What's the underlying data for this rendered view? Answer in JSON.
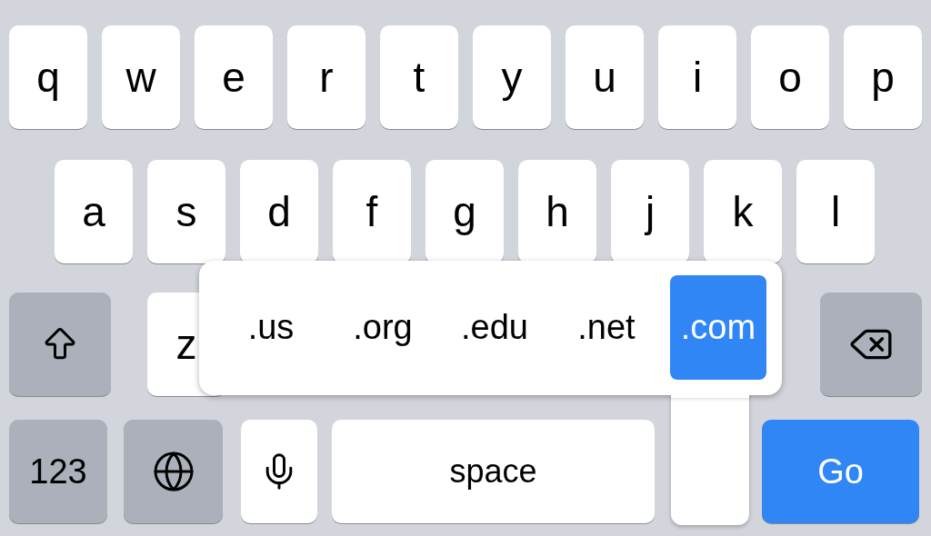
{
  "rows": [
    {
      "keys": [
        {
          "kind": "letter",
          "label": "q"
        },
        {
          "kind": "letter",
          "label": "w"
        },
        {
          "kind": "letter",
          "label": "e"
        },
        {
          "kind": "letter",
          "label": "r"
        },
        {
          "kind": "letter",
          "label": "t"
        },
        {
          "kind": "letter",
          "label": "y"
        },
        {
          "kind": "letter",
          "label": "u"
        },
        {
          "kind": "letter",
          "label": "i"
        },
        {
          "kind": "letter",
          "label": "o"
        },
        {
          "kind": "letter",
          "label": "p"
        }
      ]
    },
    {
      "keys": [
        {
          "kind": "letter",
          "label": "a"
        },
        {
          "kind": "letter",
          "label": "s"
        },
        {
          "kind": "letter",
          "label": "d"
        },
        {
          "kind": "letter",
          "label": "f"
        },
        {
          "kind": "letter",
          "label": "g"
        },
        {
          "kind": "letter",
          "label": "h"
        },
        {
          "kind": "letter",
          "label": "j"
        },
        {
          "kind": "letter",
          "label": "k"
        },
        {
          "kind": "letter",
          "label": "l"
        }
      ]
    },
    {
      "keys": [
        {
          "kind": "shift"
        },
        {
          "kind": "letter",
          "label": "z"
        },
        {
          "kind": "blank"
        },
        {
          "kind": "blank"
        },
        {
          "kind": "blank"
        },
        {
          "kind": "blank"
        },
        {
          "kind": "blank"
        },
        {
          "kind": "blank"
        },
        {
          "kind": "delete"
        }
      ]
    },
    {
      "keys": [
        {
          "kind": "numbers",
          "label": "123"
        },
        {
          "kind": "globe"
        },
        {
          "kind": "mic"
        },
        {
          "kind": "space",
          "label": "space"
        },
        {
          "kind": "stem"
        },
        {
          "kind": "go",
          "label": "Go"
        }
      ]
    }
  ],
  "popup": {
    "options": [
      {
        "label": ".us",
        "selected": false
      },
      {
        "label": ".org",
        "selected": false
      },
      {
        "label": ".edu",
        "selected": false
      },
      {
        "label": ".net",
        "selected": false
      },
      {
        "label": ".com",
        "selected": true
      }
    ]
  }
}
